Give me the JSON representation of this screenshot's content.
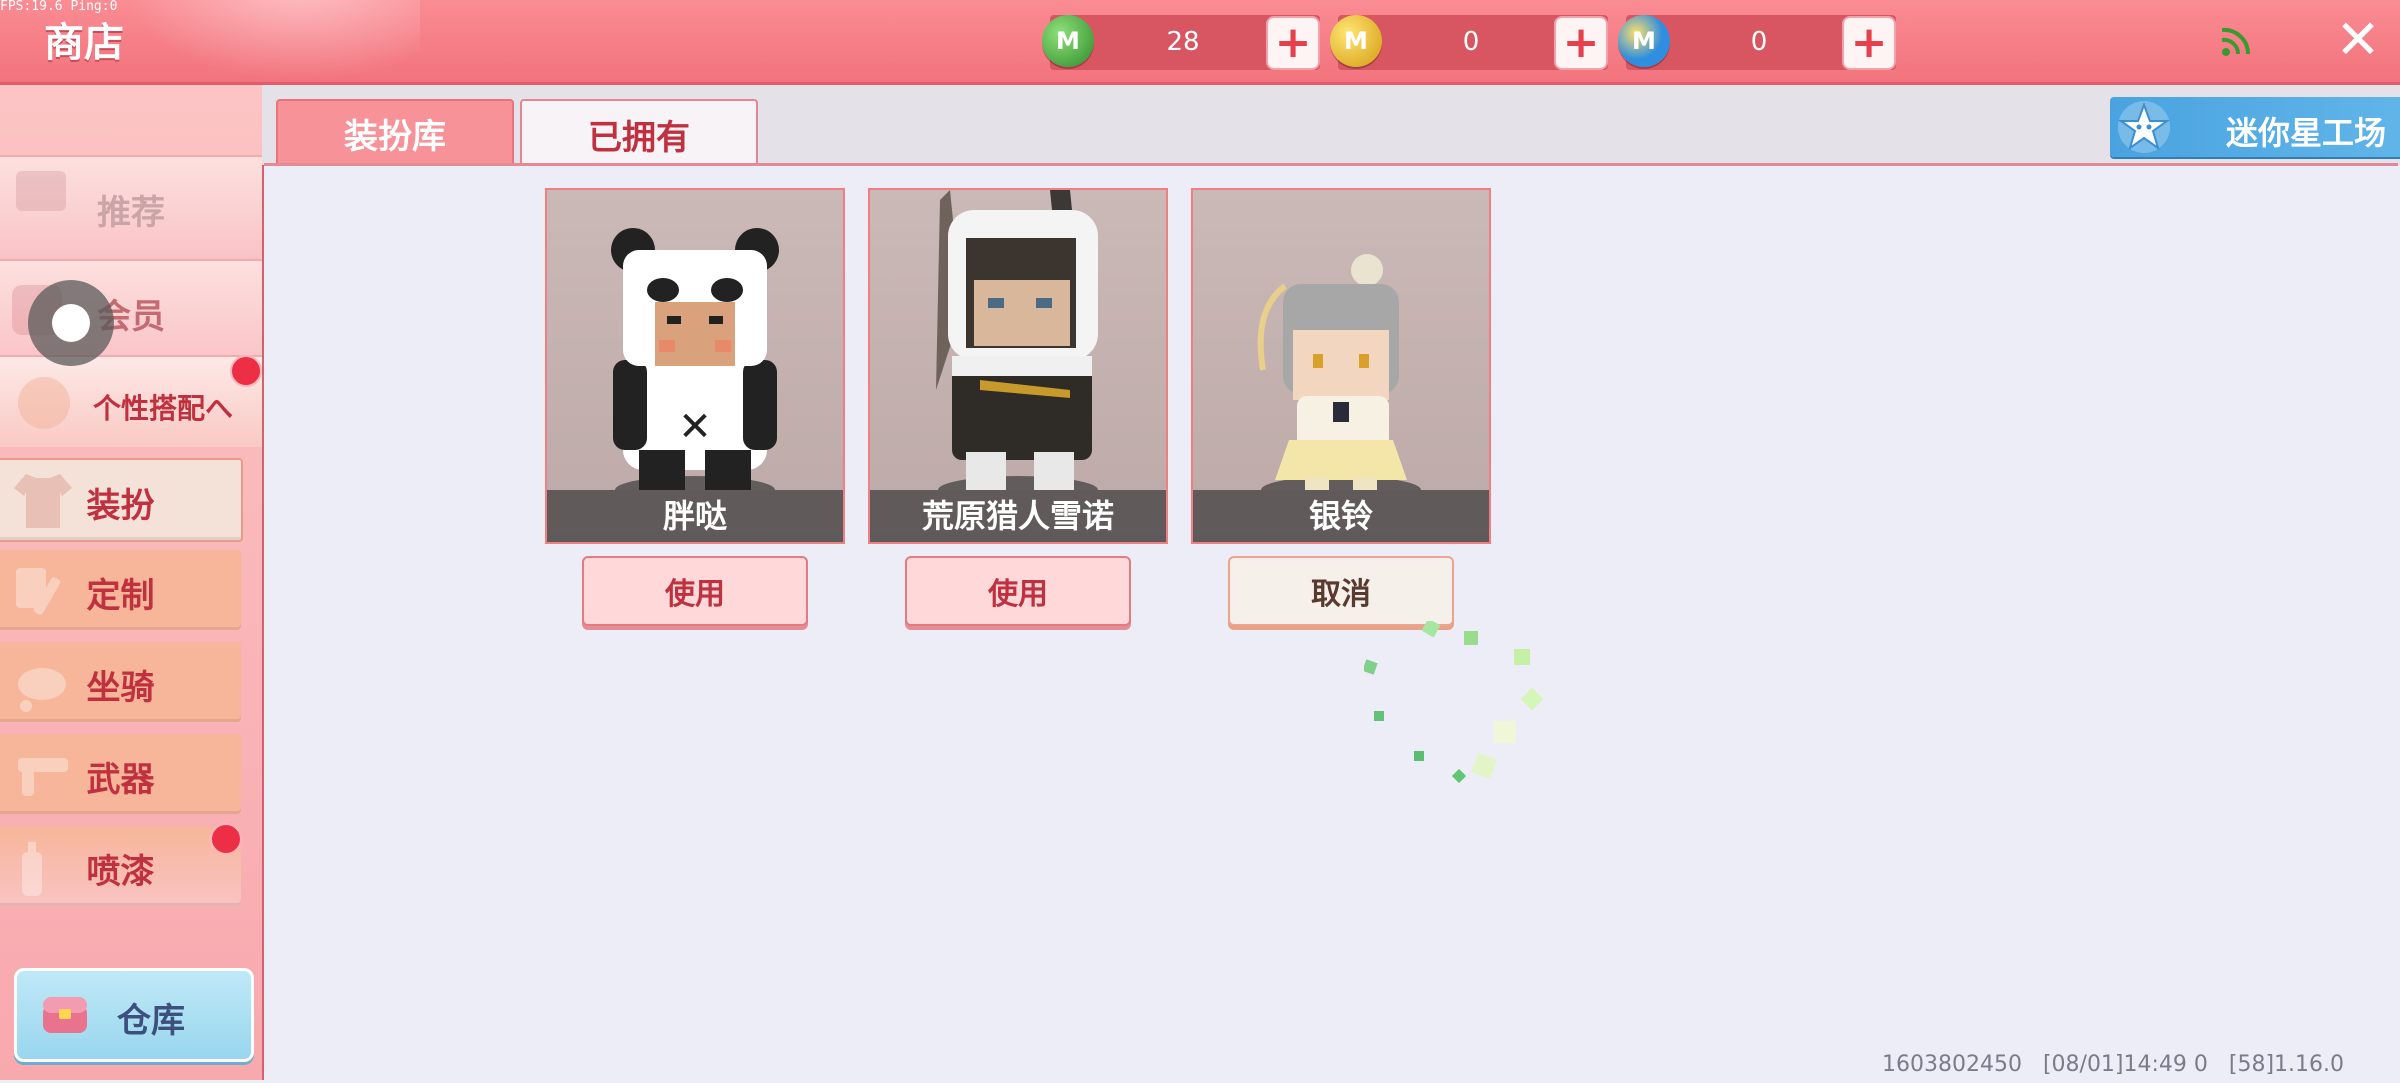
{
  "debug": "FPS:19.6  Ping:0",
  "app_title": "商店",
  "currencies": [
    {
      "name": "mini-bean",
      "icon": "green-m-coin-icon",
      "color": "#3fa33a",
      "glyph": "M",
      "amount": "28"
    },
    {
      "name": "mini-coin",
      "icon": "gold-m-coin-icon",
      "color": "#e6b91d",
      "glyph": "M",
      "amount": "0"
    },
    {
      "name": "star-coin",
      "icon": "blue-m-coin-icon",
      "color": "#2f8ee0",
      "glyph": "M",
      "amount": "0"
    }
  ],
  "header": {
    "close": "✕"
  },
  "sidebar": {
    "top_items": [
      {
        "label": "推荐",
        "color": "#c9a5a7"
      },
      {
        "label": "会员",
        "color": "#c46a72"
      },
      {
        "label": "个性搭配へ",
        "color": "#c03140"
      }
    ],
    "sub_items": [
      {
        "label": "装扮",
        "icon": "shirt-icon"
      },
      {
        "label": "定制",
        "icon": "paint-icon"
      },
      {
        "label": "坐骑",
        "icon": "mount-icon"
      },
      {
        "label": "武器",
        "icon": "gun-icon"
      },
      {
        "label": "喷漆",
        "icon": "spray-icon"
      }
    ],
    "warehouse": "仓库"
  },
  "tabs": [
    {
      "label": "装扮库"
    },
    {
      "label": "已拥有"
    }
  ],
  "studio": "迷你星工场",
  "items": [
    {
      "name": "胖哒",
      "action": "使用"
    },
    {
      "name": "荒原猎人雪诺",
      "action": "使用"
    },
    {
      "name": "银铃",
      "action": "取消"
    }
  ],
  "build_info": "1603802450   [08/01]14:49 0   [58]1.16.0"
}
